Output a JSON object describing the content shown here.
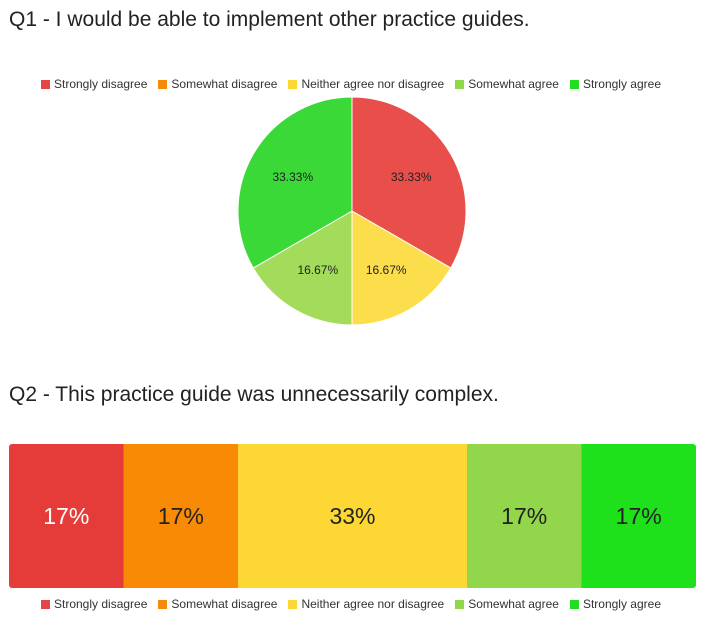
{
  "charts": {
    "q1": {
      "title": "Q1 - I would be able to implement other practice guides."
    },
    "q2": {
      "title": "Q2 - This practice guide was unnecessarily complex."
    }
  },
  "legend": [
    {
      "label": "Strongly disagree",
      "color": "#e34646"
    },
    {
      "label": "Somewhat disagree",
      "color": "#f58a0b"
    },
    {
      "label": "Neither agree nor disagree",
      "color": "#fdd835"
    },
    {
      "label": "Somewhat agree",
      "color": "#92d64c"
    },
    {
      "label": "Strongly agree",
      "color": "#22dd22"
    }
  ],
  "chart_data": [
    {
      "type": "pie",
      "title": "Q1 - I would be able to implement other practice guides.",
      "categories": [
        "Strongly disagree",
        "Somewhat disagree",
        "Neither agree nor disagree",
        "Somewhat agree",
        "Strongly agree"
      ],
      "values": [
        33.33,
        0,
        16.67,
        16.67,
        33.33
      ],
      "labels": [
        "33.33%",
        "",
        "16.67%",
        "16.67%",
        "33.33%"
      ],
      "colors": [
        "#e84e4a",
        "#f58a0b",
        "#fcdd4c",
        "#a3db5b",
        "#3ad937"
      ],
      "legend_position": "top"
    },
    {
      "type": "bar",
      "orientation": "horizontal-stacked-100",
      "title": "Q2 - This practice guide was unnecessarily complex.",
      "categories": [
        "Strongly disagree",
        "Somewhat disagree",
        "Neither agree nor disagree",
        "Somewhat agree",
        "Strongly agree"
      ],
      "values": [
        16.67,
        16.67,
        33.33,
        16.67,
        16.67
      ],
      "labels": [
        "17%",
        "17%",
        "33%",
        "17%",
        "17%"
      ],
      "colors": [
        "#e53c39",
        "#f88a05",
        "#fdd835",
        "#92d64c",
        "#1ee01b"
      ],
      "legend_position": "bottom"
    }
  ]
}
